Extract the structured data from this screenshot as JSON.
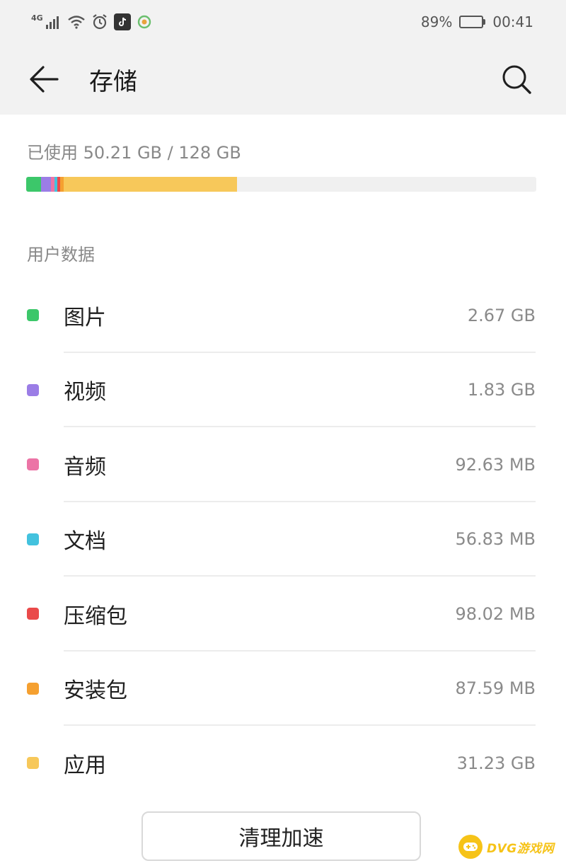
{
  "status_bar": {
    "network": "4G",
    "battery_percent_text": "89%",
    "battery_level": 0.89,
    "time": "00:41",
    "icons": [
      "signal-icon",
      "wifi-icon",
      "alarm-icon",
      "tiktok-icon",
      "app-notification-icon"
    ]
  },
  "header": {
    "title": "存储",
    "back_icon": "back-arrow-icon",
    "search_icon": "search-icon"
  },
  "storage": {
    "used_label": "已使用 50.21 GB / 128 GB",
    "used_gb": 50.21,
    "total_gb": 128
  },
  "section": {
    "title": "用户数据"
  },
  "categories": [
    {
      "label": "图片",
      "size": "2.67 GB",
      "color": "#3cc76a"
    },
    {
      "label": "视频",
      "size": "1.83 GB",
      "color": "#9b7de6"
    },
    {
      "label": "音频",
      "size": "92.63 MB",
      "color": "#ec74a6"
    },
    {
      "label": "文档",
      "size": "56.83 MB",
      "color": "#43c2de"
    },
    {
      "label": "压缩包",
      "size": "98.02 MB",
      "color": "#ea4a4a"
    },
    {
      "label": "安装包",
      "size": "87.59 MB",
      "color": "#f5a030"
    },
    {
      "label": "应用",
      "size": "31.23 GB",
      "color": "#f7c85a"
    }
  ],
  "actions": {
    "clean_label": "清理加速"
  },
  "watermark": {
    "text": "DVG游戏网"
  }
}
